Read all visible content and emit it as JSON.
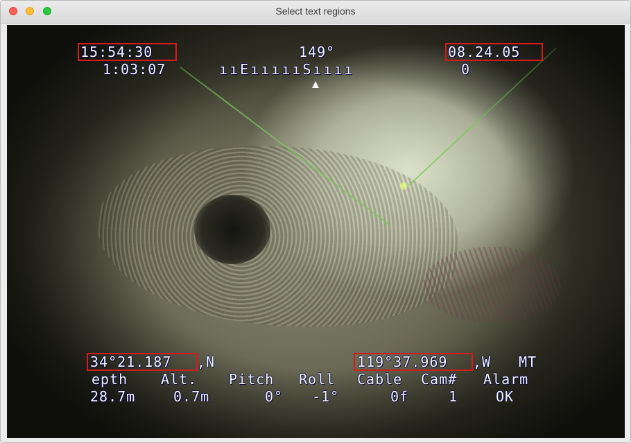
{
  "window": {
    "title": "Select text regions"
  },
  "overlay": {
    "time": "15:54:30",
    "elapsed": "1:03:07",
    "heading": "149°",
    "compass_tape": "ııEıııııSıııı",
    "date": "08.24.05",
    "date_sub": "0",
    "latitude": "34°21.187",
    "lat_hemisphere": ",N",
    "longitude": "119°37.969",
    "lon_hemisphere": ",W",
    "mt_label": "MT",
    "column_headers": [
      "epth",
      "Alt.",
      "Pitch",
      "Roll",
      "Cable",
      "Cam#",
      "Alarm"
    ],
    "column_values": [
      "28.7m",
      "0.7m",
      "0°",
      "-1°",
      "0f",
      "1",
      "OK"
    ]
  },
  "selection_color": "#d41a1a"
}
